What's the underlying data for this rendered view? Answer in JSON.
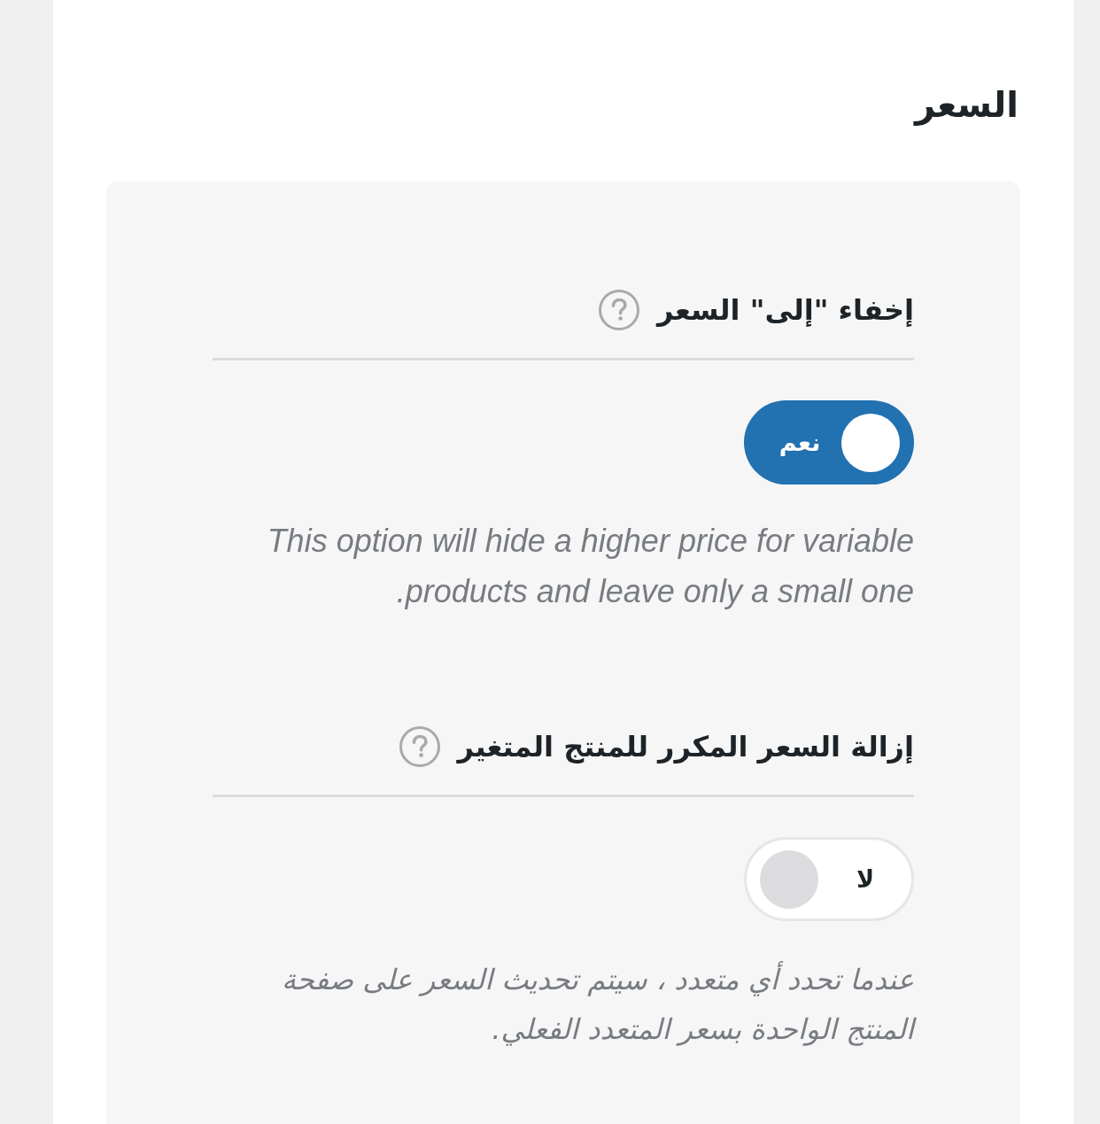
{
  "heading": "السعر",
  "settings": [
    {
      "title": "إخفاء \"إلى\" السعر",
      "on": true,
      "switch_label": "نعم",
      "description": "This option will hide a higher price for variable products and leave only a small one."
    },
    {
      "title": "إزالة السعر المكرر للمنتج المتغير",
      "on": false,
      "switch_label": "لا",
      "description": "عندما تحدد أي متعدد ، سيتم تحديث السعر على صفحة المنتج الواحدة بسعر المتعدد الفعلي."
    }
  ]
}
